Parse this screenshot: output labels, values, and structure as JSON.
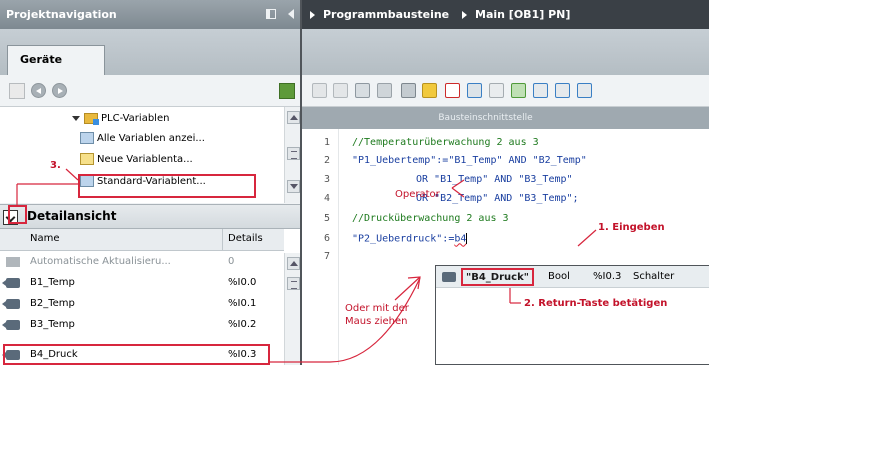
{
  "project_nav": {
    "title": "Projektnavigation",
    "tab": "Geräte"
  },
  "tree": {
    "items": [
      {
        "label": "PLC-Variablen"
      },
      {
        "label": "Alle Variablen anzei..."
      },
      {
        "label": "Neue Variablenta..."
      },
      {
        "label": "Standard-Variablent..."
      }
    ]
  },
  "detail_view": {
    "title": "Detailansicht",
    "columns": [
      "Name",
      "Details"
    ],
    "rows": [
      {
        "name": "Automatische Aktualisieru...",
        "details": "0"
      },
      {
        "name": "B1_Temp",
        "details": "%I0.0"
      },
      {
        "name": "B2_Temp",
        "details": "%I0.1"
      },
      {
        "name": "B3_Temp",
        "details": "%I0.2"
      },
      {
        "name": "B4_Druck",
        "details": "%I0.3"
      }
    ]
  },
  "breadcrumb": {
    "part1": "Programmbausteine",
    "part2": "Main [OB1] PN]"
  },
  "interface_bar": "Bausteinschnittstelle",
  "editor": {
    "lines": [
      {
        "num": "1",
        "text": "//Temperaturüberwachung 2 aus 3"
      },
      {
        "num": "2",
        "text": "\"P1_Uebertemp\":=\"B1_Temp\" AND \"B2_Temp\""
      },
      {
        "num": "3",
        "text": "OR \"B1_Temp\" AND \"B3_Temp\""
      },
      {
        "num": "4",
        "text": "OR \"B2_Temp\" AND \"B3_Temp\";"
      },
      {
        "num": "5",
        "text": "//Drucküberwachung 2 aus 3"
      },
      {
        "num": "6",
        "text": "\"P2_Ueberdruck\":=",
        "typed": "b4"
      },
      {
        "num": "7",
        "text": ""
      }
    ]
  },
  "autocomplete": {
    "name": "\"B4_Druck\"",
    "type": "Bool",
    "address": "%I0.3",
    "comment": "Schalter"
  },
  "annotations": {
    "step3": "3.",
    "operator": "Operator",
    "step1": "1. Eingeben",
    "step2": "2. Return-Taste betätigen",
    "drag_line1": "Oder mit der",
    "drag_line2": "Maus ziehen"
  },
  "colors": {
    "annotation_red": "#d7263d",
    "header_dark": "#3a4046",
    "panel_header": "#8a949b"
  }
}
